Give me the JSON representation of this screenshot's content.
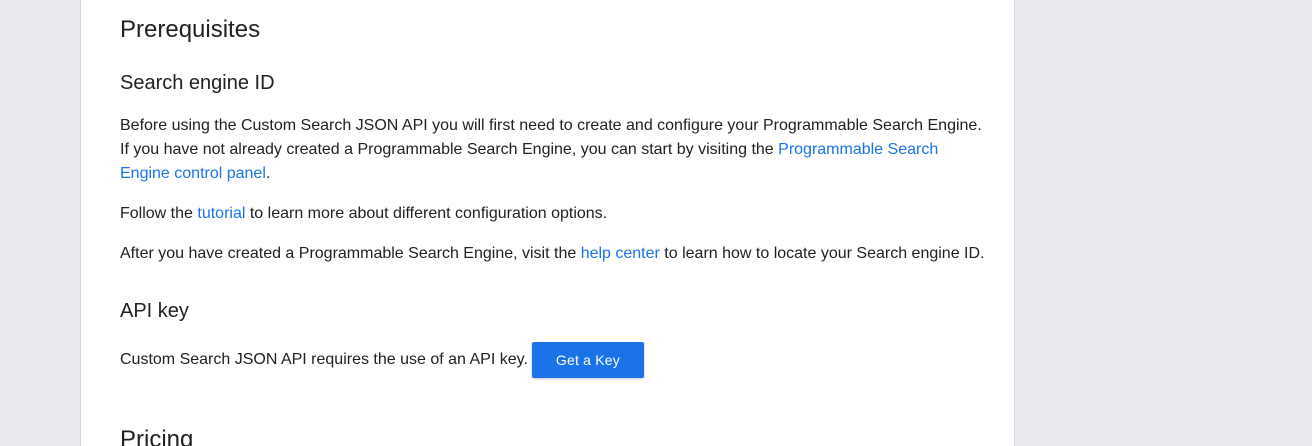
{
  "prerequisites": {
    "title": "Prerequisites"
  },
  "search_engine_id": {
    "title": "Search engine ID",
    "para1": {
      "text_before": "Before using the Custom Search JSON API you will first need to create and configure your Programmable Search Engine. If you have not already created a Programmable Search Engine, you can start by visiting the ",
      "link": "Programmable Search Engine control panel",
      "text_after": "."
    },
    "para2": {
      "text_before": "Follow the ",
      "link": "tutorial",
      "text_after": " to learn more about different configuration options."
    },
    "para3": {
      "text_before": "After you have created a Programmable Search Engine, visit the ",
      "link": "help center",
      "text_after": " to learn how to locate your Search engine ID."
    }
  },
  "api_key": {
    "title": "API key",
    "text": "Custom Search JSON API requires the use of an API key.",
    "button_label": "Get a Key"
  },
  "pricing": {
    "title": "Pricing"
  },
  "colors": {
    "link": "#1a73e8",
    "button": "#1a73e8",
    "text": "#202124",
    "background": "#e8eaed"
  }
}
